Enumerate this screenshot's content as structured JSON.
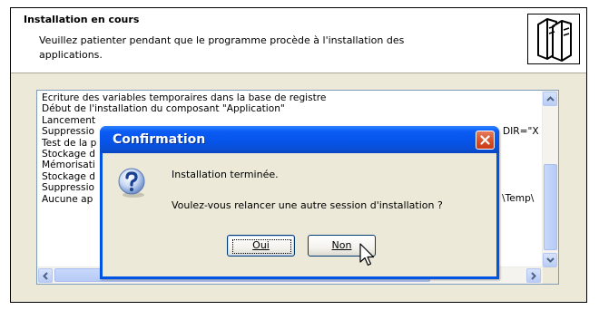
{
  "header": {
    "title": "Installation en cours",
    "description": "Veuillez patienter pendant que le programme procède à l'installation des applications.",
    "icon": "server-icon"
  },
  "log": {
    "lines": [
      "Ecriture des variables temporaires dans la base de registre",
      "Début de l'installation du composant \"Application\"",
      "Lancement",
      "Suppressio",
      "Test de la p",
      "Stockage d",
      "Mémorisati",
      "Stockage d",
      "Suppressio",
      "Aucune ap"
    ],
    "right_fragments": [
      {
        "row": 2,
        "text": "DIR=\"X"
      },
      {
        "row": 8,
        "text": "\\Temp\\"
      }
    ]
  },
  "dialog": {
    "title": "Confirmation",
    "message_line1": "Installation terminée.",
    "message_line2": "Voulez-vous relancer une autre session d'installation ?",
    "yes_label": "Oui",
    "no_label": "Non",
    "icon": "question-icon"
  },
  "colors": {
    "titlebar": "#0a5cf5",
    "close_button": "#d94b24",
    "dialog_face": "#ece9d8",
    "header_bg": "#ffffff"
  }
}
